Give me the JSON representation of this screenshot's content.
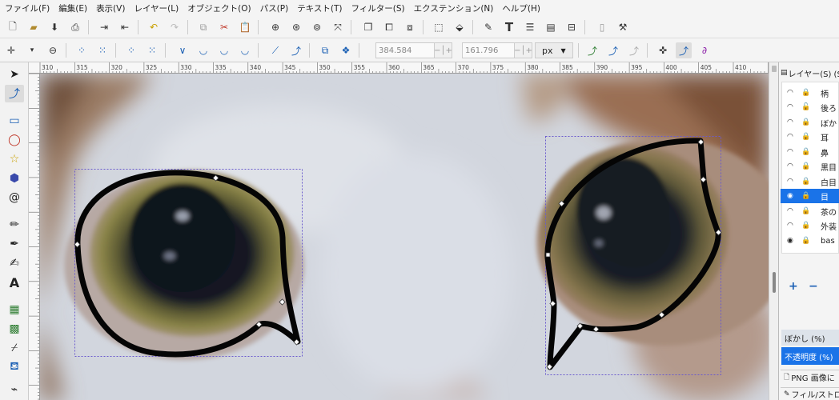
{
  "menu": [
    "ファイル(F)",
    "編集(E)",
    "表示(V)",
    "レイヤー(L)",
    "オブジェクト(O)",
    "パス(P)",
    "テキスト(T)",
    "フィルター(S)",
    "エクステンション(N)",
    "ヘルプ(H)"
  ],
  "coords": {
    "x_label": "X:",
    "x_value": "384.584",
    "y_label": "Y:",
    "y_value": "161.796",
    "unit": "px"
  },
  "ruler_ticks": [
    "310",
    "315",
    "320",
    "325",
    "330",
    "335",
    "340",
    "345",
    "350",
    "355",
    "360",
    "365",
    "370",
    "375",
    "380",
    "385",
    "390",
    "395",
    "400",
    "405",
    "410",
    "415"
  ],
  "panel": {
    "title": "レイヤー(S) (Sh",
    "layers": [
      {
        "name": "柄",
        "selected": false
      },
      {
        "name": "後ろ",
        "selected": false
      },
      {
        "name": "ぼか",
        "selected": false
      },
      {
        "name": "耳",
        "selected": false
      },
      {
        "name": "鼻",
        "selected": false
      },
      {
        "name": "黒目",
        "selected": false
      },
      {
        "name": "白目",
        "selected": false
      },
      {
        "name": "目",
        "selected": true
      },
      {
        "name": "茶の",
        "selected": false
      },
      {
        "name": "外装",
        "selected": false
      },
      {
        "name": "bas",
        "selected": false
      }
    ],
    "add_label": "+",
    "remove_label": "−",
    "blur_label": "ぼかし (%)",
    "opacity_label": "不透明度 (%)",
    "png_label": "PNG 画像に",
    "fill_label": "フィル/ストロー"
  },
  "colors": {
    "accent": "#1a73e8",
    "selection": "#6a5acd"
  }
}
